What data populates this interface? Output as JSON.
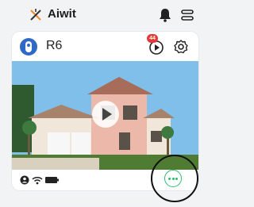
{
  "app": {
    "brand_name": "Aiwit"
  },
  "header": {
    "icons": [
      "aiwit-logo-icon",
      "bell-icon",
      "switch-icon"
    ]
  },
  "device_card": {
    "camera_name": "R6",
    "playback_badge_count": "44",
    "icons": [
      "camera-device-icon",
      "playback-icon",
      "settings-gear-icon"
    ],
    "live_view": {
      "description_icon": "play-button-icon"
    },
    "status_icons": [
      "user-icon",
      "wifi-icon",
      "battery-icon"
    ],
    "chat_icon": "chat-bubble-icon",
    "accent_color": "#2f68c6",
    "chat_color": "#2bbf6b"
  }
}
